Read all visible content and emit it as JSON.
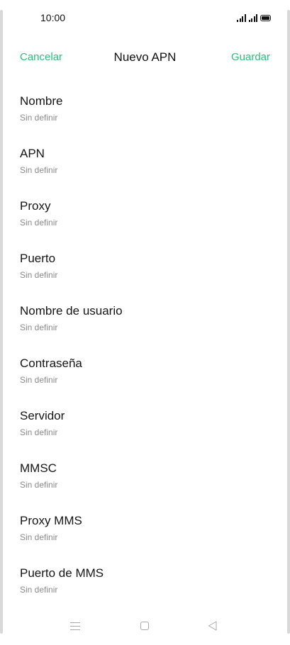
{
  "status_bar": {
    "time": "10:00",
    "icons": [
      "signal-icon",
      "signal-icon",
      "battery-icon"
    ]
  },
  "header": {
    "cancel_label": "Cancelar",
    "title": "Nuevo APN",
    "save_label": "Guardar"
  },
  "colors": {
    "accent": "#2dbe7a",
    "text_primary": "#151515",
    "text_secondary": "#8a8a8a",
    "nav_icon": "#a8a8a8"
  },
  "fields": [
    {
      "label": "Nombre",
      "value": "Sin definir"
    },
    {
      "label": "APN",
      "value": "Sin definir"
    },
    {
      "label": "Proxy",
      "value": "Sin definir"
    },
    {
      "label": "Puerto",
      "value": "Sin definir"
    },
    {
      "label": "Nombre de usuario",
      "value": "Sin definir"
    },
    {
      "label": "Contraseña",
      "value": "Sin definir"
    },
    {
      "label": "Servidor",
      "value": "Sin definir"
    },
    {
      "label": "MMSC",
      "value": "Sin definir"
    },
    {
      "label": "Proxy MMS",
      "value": "Sin definir"
    },
    {
      "label": "Puerto de MMS",
      "value": "Sin definir"
    }
  ],
  "nav_bar": {
    "icons": [
      "menu-icon",
      "home-icon",
      "back-icon"
    ]
  }
}
